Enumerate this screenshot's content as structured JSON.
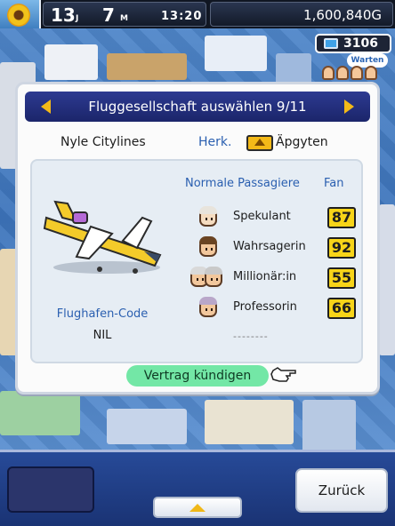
{
  "status_bar": {
    "month": "13",
    "month_unit": "J",
    "day": "7",
    "day_unit": "M",
    "time": "13:20",
    "money": "1,600,840G",
    "points": "3106",
    "queue_label": "Warten"
  },
  "dialog": {
    "title": "Fluggesellschaft auswählen 9/11",
    "airline_name": "Nyle Citylines",
    "origin_label": "Herk.",
    "origin_value": "Äpgyten",
    "airport_code_label": "Flughafen-Code",
    "airport_code_value": "NIL",
    "passengers_header": "Normale Passagiere",
    "fan_header": "Fan",
    "passengers": [
      {
        "name": "Spekulant",
        "fan": "87"
      },
      {
        "name": "Wahrsagerin",
        "fan": "92"
      },
      {
        "name": "Millionär:in",
        "fan": "55"
      },
      {
        "name": "Professorin",
        "fan": "66"
      }
    ],
    "empty_slot": "--------",
    "terminate_label": "Vertrag kündigen"
  },
  "bottom": {
    "back_label": "Zurück"
  },
  "colors": {
    "title_bar": "#1f2a78",
    "accent_yellow": "#f3b918",
    "terminate_green": "#73e7a6",
    "label_blue": "#2a5fb0"
  }
}
